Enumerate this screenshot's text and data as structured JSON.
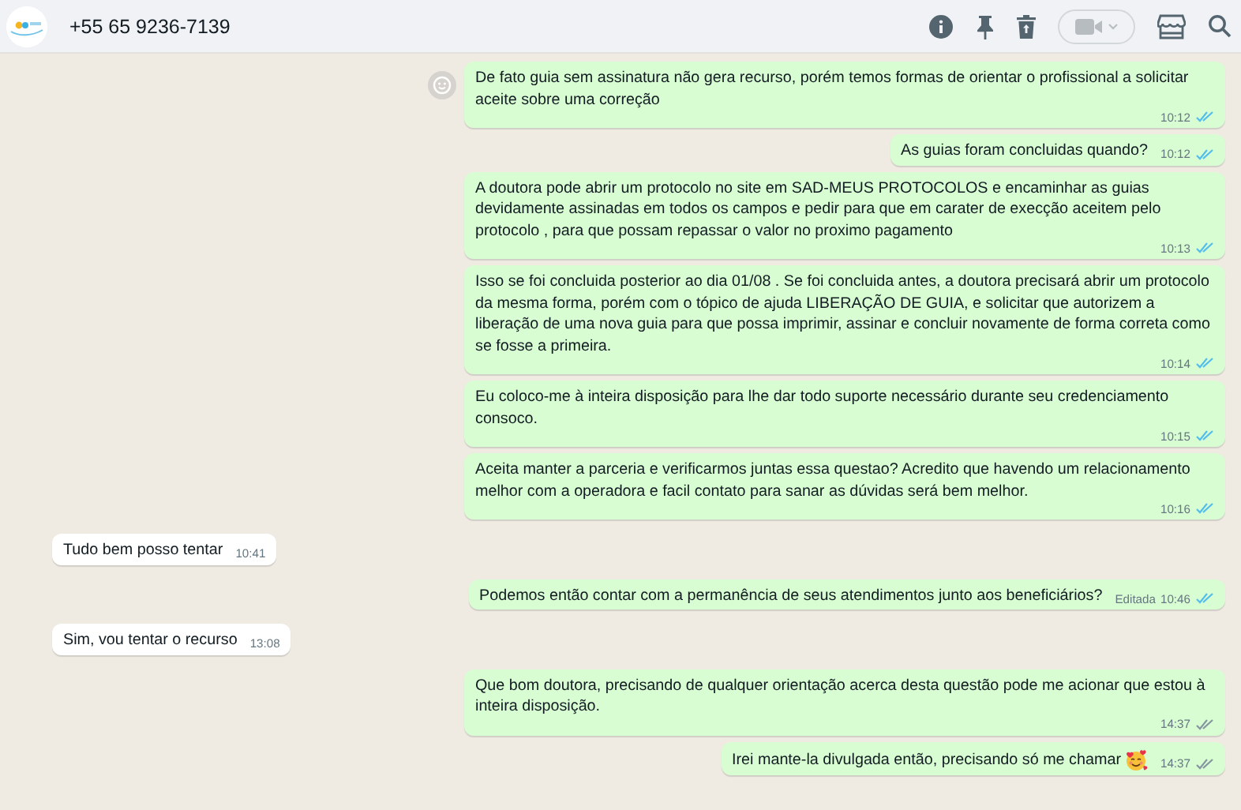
{
  "header": {
    "title": "+55 65 9236-7139",
    "video_call": {
      "disabled": true
    }
  },
  "messages": [
    {
      "outgoing": true,
      "text": "De fato guia sem assinatura não gera recurso, porém temos formas de orientar o profissional  a solicitar aceite sobre uma correção",
      "time": "10:12",
      "read": true,
      "reaction_button": true
    },
    {
      "outgoing": true,
      "text": "As guias foram concluidas quando?",
      "time": "10:12",
      "read": true
    },
    {
      "outgoing": true,
      "text": "A doutora pode abrir um protocolo no site em SAD-MEUS PROTOCOLOS e encaminhar as guias devidamente assinadas em todos os campos e pedir para que em carater de execção aceitem pelo protocolo , para que possam repassar o valor no proximo pagamento",
      "time": "10:13",
      "read": true
    },
    {
      "outgoing": true,
      "text": "Isso se foi concluida posterior ao dia 01/08 . Se foi concluida antes, a doutora precisará abrir um protocolo da mesma forma, porém com o tópico de ajuda LIBERAÇÃO DE GUIA, e solicitar que autorizem a liberação de uma nova guia para que possa imprimir, assinar e concluir novamente de forma correta como se fosse a primeira.",
      "time": "10:14",
      "read": true
    },
    {
      "outgoing": true,
      "text": "Eu coloco-me à inteira disposição para lhe dar todo suporte necessário durante seu credenciamento consoco.",
      "time": "10:15",
      "read": true
    },
    {
      "outgoing": true,
      "text": "Aceita manter a parceria e verificarmos juntas essa questao? Acredito que havendo um relacionamento melhor com a operadora e facil contato para sanar as dúvidas será bem melhor.",
      "time": "10:16",
      "read": true
    },
    {
      "outgoing": false,
      "text": "Tudo bem posso tentar",
      "time": "10:41"
    },
    {
      "outgoing": true,
      "text": "Podemos então contar com a permanência de seus atendimentos junto aos beneficiários?",
      "edited": "Editada",
      "time": "10:46",
      "read": true
    },
    {
      "outgoing": false,
      "text": "Sim, vou tentar o recurso",
      "time": "13:08"
    },
    {
      "outgoing": true,
      "text": "Que bom doutora, precisando de qualquer orientação acerca desta questão pode me acionar que estou à inteira disposição.",
      "time": "14:37",
      "read": false
    },
    {
      "outgoing": true,
      "text": "Irei mante-la divulgada então, precisando só me chamar",
      "emoji": true,
      "time": "14:37",
      "read": false
    }
  ]
}
